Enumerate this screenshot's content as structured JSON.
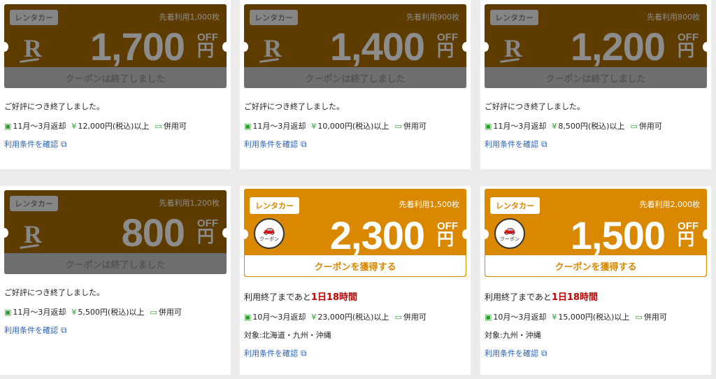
{
  "cards": [
    {
      "tag": "レンタカー",
      "limit": "先着利用1,000枚",
      "amount": "1,700",
      "off": "OFF",
      "yen": "円",
      "status": "クーポンは終了しました",
      "message": "ご好評につき終了しました。",
      "period": "11月～3月返却",
      "minimum": "12,000円(税込)以上",
      "combinable": "併用可",
      "terms_link": "利用条件を確認"
    },
    {
      "tag": "レンタカー",
      "limit": "先着利用900枚",
      "amount": "1,400",
      "off": "OFF",
      "yen": "円",
      "status": "クーポンは終了しました",
      "message": "ご好評につき終了しました。",
      "period": "11月～3月返却",
      "minimum": "10,000円(税込)以上",
      "combinable": "併用可",
      "terms_link": "利用条件を確認"
    },
    {
      "tag": "レンタカー",
      "limit": "先着利用800枚",
      "amount": "1,200",
      "off": "OFF",
      "yen": "円",
      "status": "クーポンは終了しました",
      "message": "ご好評につき終了しました。",
      "period": "11月～3月返却",
      "minimum": "8,500円(税込)以上",
      "combinable": "併用可",
      "terms_link": "利用条件を確認"
    },
    {
      "tag": "レンタカー",
      "limit": "先着利用1,200枚",
      "amount": "800",
      "off": "OFF",
      "yen": "円",
      "status": "クーポンは終了しました",
      "message": "ご好評につき終了しました。",
      "period": "11月～3月返却",
      "minimum": "5,500円(税込)以上",
      "combinable": "併用可",
      "terms_link": "利用条件を確認"
    },
    {
      "tag": "レンタカー",
      "limit": "先着利用1,500枚",
      "amount": "2,300",
      "off": "OFF",
      "yen": "円",
      "badge_label": "クーポン",
      "status": "クーポンを獲得する",
      "message_prefix": "利用終了まであと",
      "remaining": "1日18時間",
      "period": "10月～3月返却",
      "minimum": "23,000円(税込)以上",
      "combinable": "併用可",
      "target": "対象:北海道・九州・沖縄",
      "terms_link": "利用条件を確認"
    },
    {
      "tag": "レンタカー",
      "limit": "先着利用2,000枚",
      "amount": "1,500",
      "off": "OFF",
      "yen": "円",
      "badge_label": "クーポン",
      "status": "クーポンを獲得する",
      "message_prefix": "利用終了まであと",
      "remaining": "1日18時間",
      "period": "10月～3月返却",
      "minimum": "15,000円(税込)以上",
      "combinable": "併用可",
      "target": "対象:九州・沖縄",
      "terms_link": "利用条件を確認"
    }
  ],
  "colors": {
    "ended_bg": "#5e3c00",
    "active_bg": "#d98800",
    "remaining": "#c00000",
    "link": "#2860b8",
    "icon": "#2a9d2a"
  },
  "icons": {
    "period": "calendar-icon",
    "minimum": "yen-circle-icon",
    "combinable": "ticket-icon",
    "terms": "external-link-icon",
    "logo": "rakuten-r-logo",
    "badge": "car-badge-icon"
  }
}
